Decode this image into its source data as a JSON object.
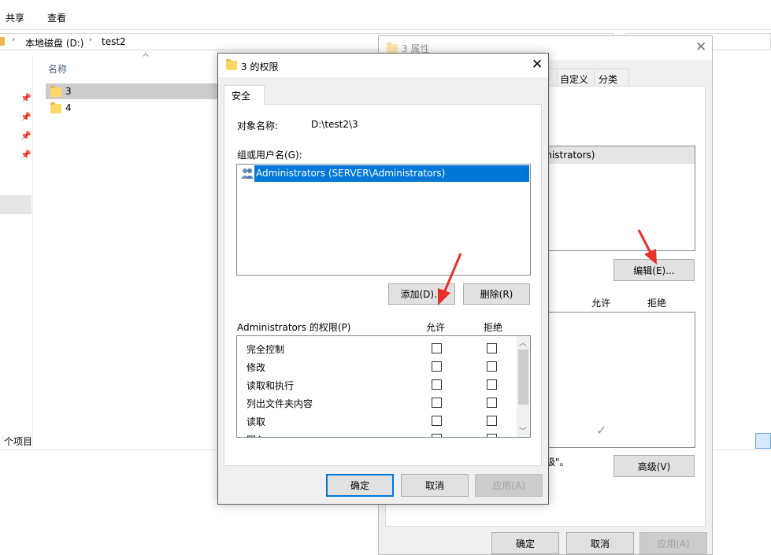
{
  "ribbon": {
    "tabs": [
      "共享",
      "查看"
    ]
  },
  "address": {
    "path": [
      "本地磁盘 (D:)",
      "test2"
    ]
  },
  "file_list": {
    "column_name": "名称",
    "items": [
      {
        "name": "3",
        "selected": true
      },
      {
        "name": "4",
        "selected": false
      }
    ]
  },
  "status_bar": {
    "items_text": "个项目"
  },
  "properties_dialog": {
    "title": "3 属性",
    "tabs": [
      "自定义",
      "分类"
    ],
    "group_user_partial": "inistrators)",
    "edit_button": "编辑(E)...",
    "perm_header_allow": "允许",
    "perm_header_deny": "拒绝",
    "advanced_text_partial": "高级\"。",
    "advanced_button": "高级(V)",
    "ok_button": "确定",
    "cancel_button": "取消",
    "apply_button": "应用(A)"
  },
  "permissions_dialog": {
    "title": "3 的权限",
    "tab_security": "安全",
    "object_name_label": "对象名称:",
    "object_name_value": "D:\\test2\\3",
    "group_label": "组或用户名(G):",
    "users": [
      {
        "name": "Administrators (SERVER\\Administrators)",
        "selected": true
      }
    ],
    "add_button": "添加(D)...",
    "remove_button": "删除(R)",
    "perm_title": "Administrators 的权限(P)",
    "perm_header_allow": "允许",
    "perm_header_deny": "拒绝",
    "permissions": [
      {
        "name": "完全控制",
        "allow": false,
        "deny": false
      },
      {
        "name": "修改",
        "allow": false,
        "deny": false
      },
      {
        "name": "读取和执行",
        "allow": false,
        "deny": false
      },
      {
        "name": "列出文件夹内容",
        "allow": false,
        "deny": false
      },
      {
        "name": "读取",
        "allow": false,
        "deny": false
      },
      {
        "name": "写入",
        "allow": false,
        "deny": false
      }
    ],
    "ok_button": "确定",
    "cancel_button": "取消",
    "apply_button": "应用(A)"
  },
  "colors": {
    "accent": "#0078d7",
    "selection": "#0078d7",
    "arrow": "#e8312a",
    "folder": "#ffd766"
  }
}
